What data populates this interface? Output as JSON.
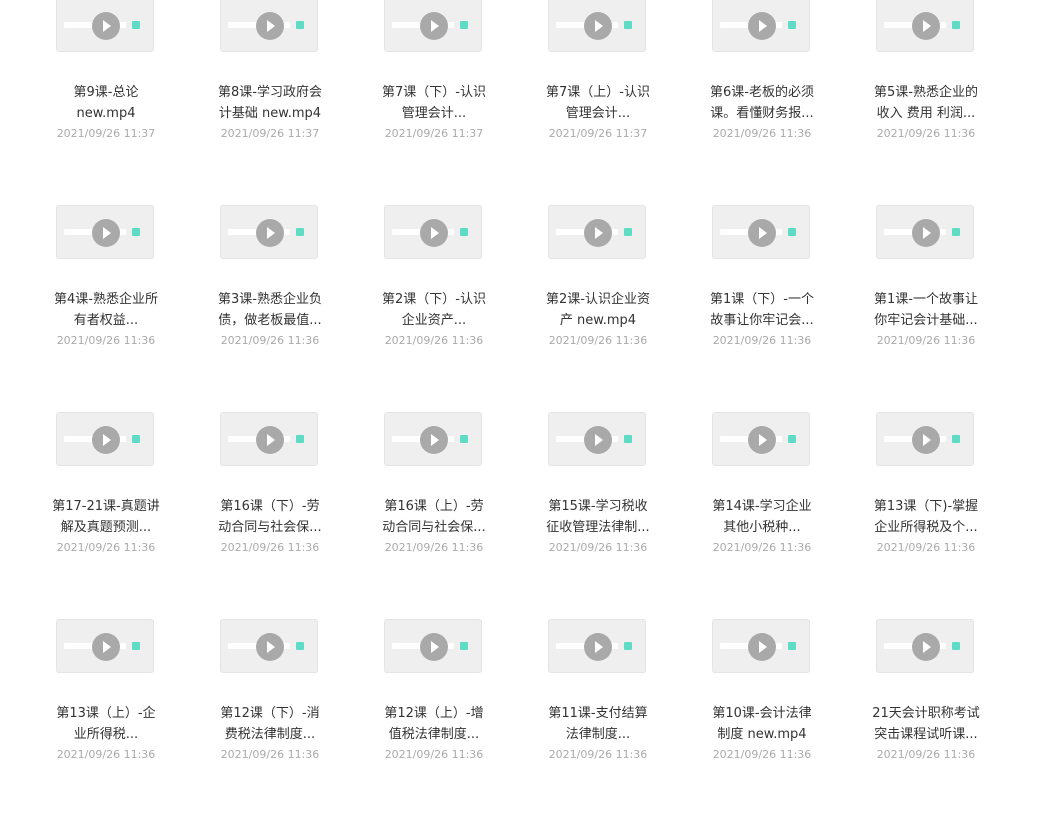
{
  "files": [
    {
      "name_line1": "第9课-总论",
      "name_line2": "new.mp4",
      "date": "2021/09/26 11:37",
      "icon": "video-file-icon"
    },
    {
      "name_line1": "第8课-学习政府会",
      "name_line2": "计基础 new.mp4",
      "date": "2021/09/26 11:37",
      "icon": "video-file-icon"
    },
    {
      "name_line1": "第7课（下）-认识",
      "name_line2": "管理会计...",
      "date": "2021/09/26 11:37",
      "icon": "video-file-icon"
    },
    {
      "name_line1": "第7课（上）-认识",
      "name_line2": "管理会计...",
      "date": "2021/09/26 11:37",
      "icon": "video-file-icon"
    },
    {
      "name_line1": "第6课-老板的必须",
      "name_line2": "课。看懂财务报...",
      "date": "2021/09/26 11:36",
      "icon": "video-file-icon"
    },
    {
      "name_line1": "第5课-熟悉企业的",
      "name_line2": "收入 费用 利润...",
      "date": "2021/09/26 11:36",
      "icon": "video-file-icon"
    },
    {
      "name_line1": "第4课-熟悉企业所",
      "name_line2": "有者权益...",
      "date": "2021/09/26 11:36",
      "icon": "video-file-icon"
    },
    {
      "name_line1": "第3课-熟悉企业负",
      "name_line2": "债，做老板最值...",
      "date": "2021/09/26 11:36",
      "icon": "video-file-icon"
    },
    {
      "name_line1": "第2课（下）-认识",
      "name_line2": "企业资产...",
      "date": "2021/09/26 11:36",
      "icon": "video-file-icon"
    },
    {
      "name_line1": "第2课-认识企业资",
      "name_line2": "产 new.mp4",
      "date": "2021/09/26 11:36",
      "icon": "video-file-icon"
    },
    {
      "name_line1": "第1课（下）-一个",
      "name_line2": "故事让你牢记会...",
      "date": "2021/09/26 11:36",
      "icon": "video-file-icon"
    },
    {
      "name_line1": "第1课-一个故事让",
      "name_line2": "你牢记会计基础...",
      "date": "2021/09/26 11:36",
      "icon": "video-file-icon"
    },
    {
      "name_line1": "第17-21课-真题讲",
      "name_line2": "解及真题预测...",
      "date": "2021/09/26 11:36",
      "icon": "video-file-icon"
    },
    {
      "name_line1": "第16课（下）-劳",
      "name_line2": "动合同与社会保...",
      "date": "2021/09/26 11:36",
      "icon": "video-file-icon"
    },
    {
      "name_line1": "第16课（上）-劳",
      "name_line2": "动合同与社会保...",
      "date": "2021/09/26 11:36",
      "icon": "video-file-icon"
    },
    {
      "name_line1": "第15课-学习税收",
      "name_line2": "征收管理法律制...",
      "date": "2021/09/26 11:36",
      "icon": "video-file-icon"
    },
    {
      "name_line1": "第14课-学习企业",
      "name_line2": "其他小税种...",
      "date": "2021/09/26 11:36",
      "icon": "video-file-icon"
    },
    {
      "name_line1": "第13课（下)-掌握",
      "name_line2": "企业所得税及个...",
      "date": "2021/09/26 11:36",
      "icon": "video-file-icon"
    },
    {
      "name_line1": "第13课（上）-企",
      "name_line2": "业所得税...",
      "date": "2021/09/26 11:36",
      "icon": "video-file-icon"
    },
    {
      "name_line1": "第12课（下）-消",
      "name_line2": "费税法律制度...",
      "date": "2021/09/26 11:36",
      "icon": "video-file-icon"
    },
    {
      "name_line1": "第12课（上）-增",
      "name_line2": "值税法律制度...",
      "date": "2021/09/26 11:36",
      "icon": "video-file-icon"
    },
    {
      "name_line1": "第11课-支付结算",
      "name_line2": "法律制度...",
      "date": "2021/09/26 11:36",
      "icon": "video-file-icon"
    },
    {
      "name_line1": "第10课-会计法律",
      "name_line2": "制度 new.mp4",
      "date": "2021/09/26 11:36",
      "icon": "video-file-icon"
    },
    {
      "name_line1": "21天会计职称考试",
      "name_line2": "突击课程试听课...",
      "date": "2021/09/26 11:36",
      "icon": "video-file-icon"
    }
  ],
  "colors": {
    "thumb_bg": "#efefef",
    "play_btn": "#a9a9a9",
    "accent_dot": "#5fdcc6",
    "name_text": "#333333",
    "date_text": "#aaaaaa"
  }
}
